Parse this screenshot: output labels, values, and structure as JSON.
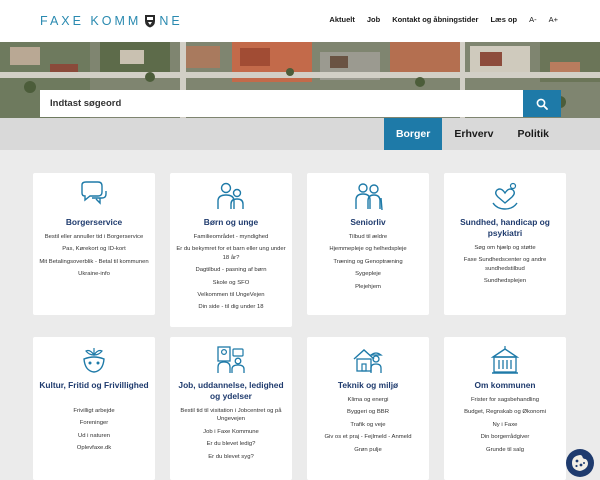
{
  "header": {
    "logo_text_left": "FAXE KOMM",
    "logo_text_right": "NE",
    "nav": [
      "Aktuelt",
      "Job",
      "Kontakt og åbningstider",
      "Læs op"
    ],
    "font_small": "A-",
    "font_large": "A+"
  },
  "search": {
    "placeholder": "Indtast søgeord"
  },
  "tabs": [
    "Borger",
    "Erhverv",
    "Politik"
  ],
  "colors": {
    "brand_blue": "#1e7aa8",
    "title_navy": "#1f3b6e",
    "logo_teal": "#2a8ab0"
  },
  "cards": [
    {
      "icon": "speech-bubbles-icon",
      "title": "Borgerservice",
      "links": [
        "Bestil eller annuller tid i Borgerservice",
        "Pas, Kørekort og ID-kort",
        "Mit Betalingsoverblik - Betal til kommunen",
        "Ukraine-info"
      ]
    },
    {
      "icon": "parent-child-icon",
      "title": "Børn og unge",
      "links": [
        "Familieområdet - myndighed",
        "Er du bekymret for et barn eller ung under 18 år?",
        "Dagtilbud - pasning af børn",
        "Skole og SFO",
        "Velkommen til UngeVejen",
        "Din side - til dig under 18"
      ]
    },
    {
      "icon": "elderly-couple-icon",
      "title": "Seniorliv",
      "links": [
        "Tilbud til ældre",
        "Hjemmepleje og helhedspleje",
        "Træning og Genoptræning",
        "Sygepleje",
        "Plejehjem"
      ]
    },
    {
      "icon": "heart-hand-icon",
      "title": "Sundhed, handicap og psykiatri",
      "links": [
        "Søg om hjælp og støtte",
        "Faxe Sundhedscenter og andre sundhedstilbud",
        "Sundhedsplejen"
      ]
    },
    {
      "icon": "mask-leaves-icon",
      "title": "Kultur, Fritid og Frivillighed",
      "links": [
        "Frivilligt arbejde",
        "Foreninger",
        "Ud i naturen",
        "Oplevfaxe.dk"
      ]
    },
    {
      "icon": "job-people-icon",
      "title": "Job, uddannelse, ledighed og ydelser",
      "links": [
        "Bestil tid til visitation i Jobcentret og på Ungevejen",
        "Job i Faxe Kommune",
        "Er du blevet ledig?",
        "Er du blevet syg?"
      ]
    },
    {
      "icon": "worker-house-icon",
      "title": "Teknik og miljø",
      "links": [
        "Klima og energi",
        "Byggeri og BBR",
        "Trafik og veje",
        "Giv os et praj - Fejlmeld - Anmeld",
        "Grøn pulje"
      ]
    },
    {
      "icon": "town-hall-icon",
      "title": "Om kommunen",
      "links": [
        "Frister for sagsbehandling",
        "Budget, Regnskab og Økonomi",
        "Ny i Faxe",
        "Din borgerrådgiver",
        "Grunde til salg"
      ]
    }
  ]
}
